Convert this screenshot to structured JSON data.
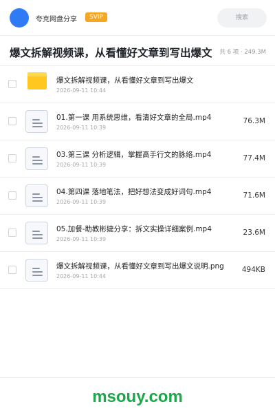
{
  "header": {
    "brand": "夸克网盘分享",
    "badge": "SVIP",
    "search_label": "搜索"
  },
  "folder": {
    "title": "爆文拆解视频课，从看懂好文章到写出爆文",
    "meta": "共 6 项 · 249.3M"
  },
  "files": [
    {
      "icon": "folder-icon",
      "name": "爆文拆解视频课，从看懂好文章到写出爆文",
      "date": "2026-09-11 10:44",
      "size": ""
    },
    {
      "icon": "file-icon",
      "name": "01.第一课 用系统思维，看清好文章的全局.mp4",
      "date": "2026-09-11 10:39",
      "size": "76.3M"
    },
    {
      "icon": "file-icon",
      "name": "03.第三课 分析逻辑，掌握高手行文的脉络.mp4",
      "date": "2026-09-11 10:39",
      "size": "77.4M"
    },
    {
      "icon": "file-icon",
      "name": "04.第四课 落地笔法，把好想法变成好词句.mp4",
      "date": "2026-09-11 10:39",
      "size": "71.6M"
    },
    {
      "icon": "file-icon",
      "name": "05.加餐-助教彬婕分享：拆文实操详细案例.mp4",
      "date": "2026-09-11 10:39",
      "size": "23.6M"
    },
    {
      "icon": "file-icon",
      "name": "爆文拆解视频课，从看懂好文章到写出爆文说明.png",
      "date": "2026-09-11 10:44",
      "size": "494KB"
    }
  ],
  "watermark": "msouy.com",
  "colors": {
    "accent": "#2f7bf5",
    "badge": "#f5a623",
    "folder": "#ffc71f",
    "watermark": "#1aa84a"
  }
}
